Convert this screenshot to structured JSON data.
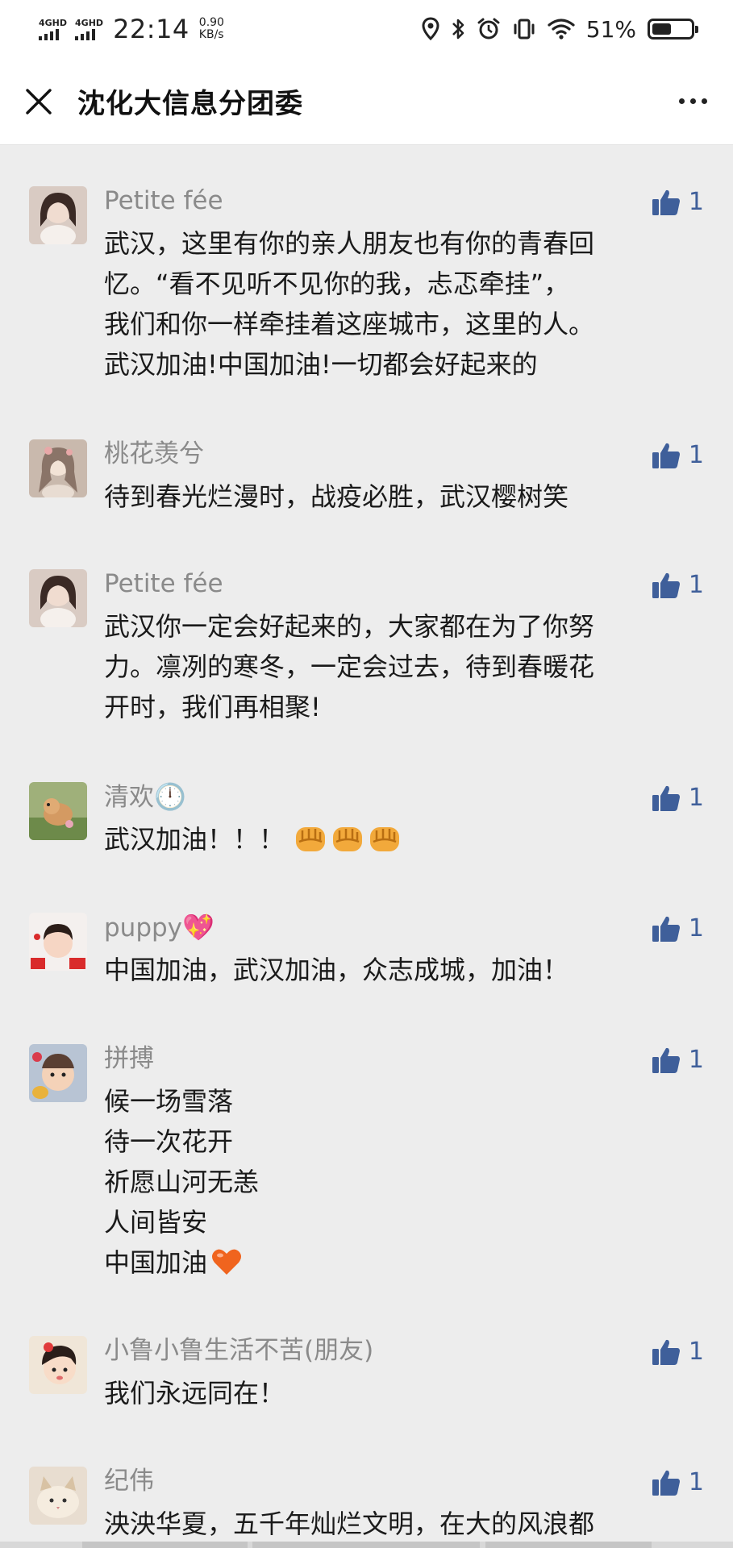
{
  "status_bar": {
    "sim1": "4GHD",
    "sim2": "4GHD",
    "time": "22:14",
    "net_speed_value": "0.90",
    "net_speed_unit": "KB/s",
    "battery_percent": "51%",
    "battery_level": 0.51,
    "icons": [
      "location-icon",
      "bluetooth-icon",
      "alarm-icon",
      "vibrate-icon",
      "wifi-icon",
      "battery-icon"
    ]
  },
  "nav": {
    "title": "沈化大信息分团委",
    "close_icon": "close-icon",
    "more_icon": "more-icon"
  },
  "comments": [
    {
      "name": "Petite fée",
      "likes": "1",
      "lines": [
        "武汉，这里有你的亲人朋友也有你的青春回",
        "忆。“看不见听不见你的我，忐忑牵挂”，",
        "我们和你一样牵挂着这座城市，这里的人。",
        "武汉加油!中国加油!一切都会好起来的"
      ]
    },
    {
      "name": "桃花羡兮",
      "likes": "1",
      "lines": [
        "待到春光烂漫时，战疫必胜，武汉樱树笑"
      ]
    },
    {
      "name": "Petite fée",
      "likes": "1",
      "lines": [
        "武汉你一定会好起来的，大家都在为了你努",
        "力。凛冽的寒冬，一定会过去，待到春暖花",
        "开时，我们再相聚!"
      ]
    },
    {
      "name": "清欢",
      "name_emoji": "🕛",
      "likes": "1",
      "lines": [
        "武汉加油！！！"
      ]
    },
    {
      "name": "puppy",
      "name_emoji": "💖",
      "likes": "1",
      "lines": [
        "中国加油，武汉加油，众志成城，加油！"
      ]
    },
    {
      "name": "拼搏",
      "likes": "1",
      "lines": [
        "候一场雪落",
        "待一次花开",
        "祈愿山河无恙",
        "人间皆安",
        "中国加油"
      ]
    },
    {
      "name": "小鲁小鲁生活不苦(朋友)",
      "likes": "1",
      "lines": [
        "我们永远同在！"
      ]
    },
    {
      "name": "纪伟",
      "likes": "1",
      "lines": [
        "泱泱华夏，五千年灿烂文明，在大的风浪都"
      ]
    }
  ],
  "colors": {
    "page_bg": "#ededed",
    "bar_bg": "#ffffff",
    "name": "#8a8a8a",
    "like": "#3f5f9a"
  }
}
